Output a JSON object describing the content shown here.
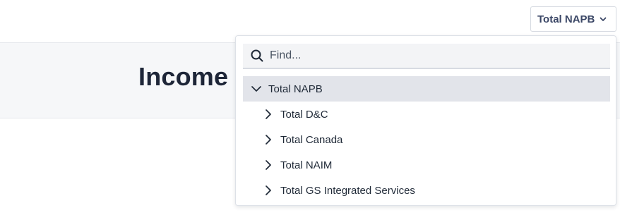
{
  "page": {
    "title": "Income S"
  },
  "scope_selector": {
    "label": "Total NAPB",
    "icon": "chevron-down-icon"
  },
  "dropdown": {
    "search": {
      "placeholder": "Find...",
      "value": "",
      "icon": "search-icon"
    },
    "tree": [
      {
        "label": "Total NAPB",
        "expanded": true,
        "selected": true,
        "level": 0
      },
      {
        "label": "Total D&C",
        "expanded": false,
        "selected": false,
        "level": 1
      },
      {
        "label": "Total Canada",
        "expanded": false,
        "selected": false,
        "level": 1
      },
      {
        "label": "Total NAIM",
        "expanded": false,
        "selected": false,
        "level": 1
      },
      {
        "label": "Total GS Integrated Services",
        "expanded": false,
        "selected": false,
        "level": 1
      }
    ]
  },
  "colors": {
    "accent_text": "#3b4766",
    "selected_row": "#e2e4ea",
    "header_band": "#f6f7f9"
  }
}
